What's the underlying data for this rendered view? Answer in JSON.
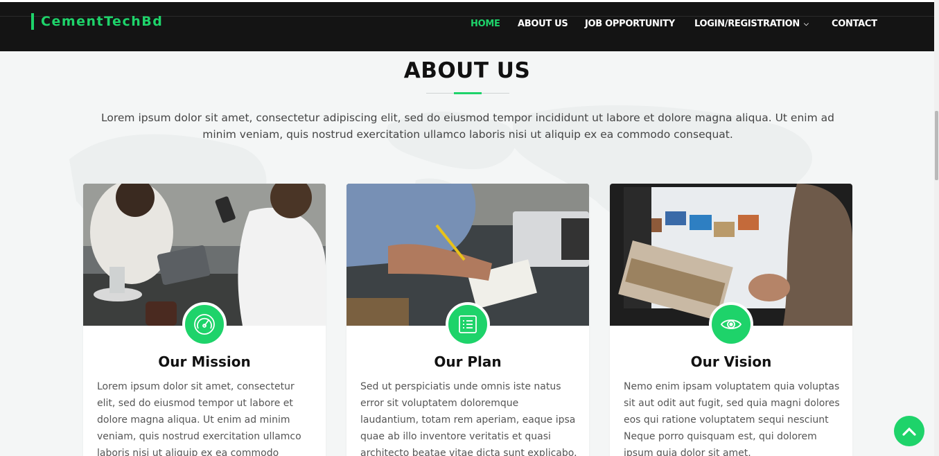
{
  "brand": {
    "name": "CementTechBd"
  },
  "nav": {
    "items": [
      {
        "label": "HOME",
        "active": true
      },
      {
        "label": "ABOUT US"
      },
      {
        "label": "JOB OPPORTUNITY"
      },
      {
        "label": "LOGIN/REGISTRATION",
        "has_dropdown": true
      },
      {
        "label": "CONTACT"
      }
    ]
  },
  "section": {
    "title": "ABOUT US",
    "intro": "Lorem ipsum dolor sit amet, consectetur adipiscing elit, sed do eiusmod tempor incididunt ut labore et dolore magna aliqua. Ut enim ad minim veniam, quis nostrud exercitation ullamco laboris nisi ut aliquip ex ea commodo consequat."
  },
  "cards": [
    {
      "icon": "speedometer-icon",
      "title": "Our Mission",
      "text": "Lorem ipsum dolor sit amet, consectetur elit, sed do eiusmod tempor ut labore et dolore magna aliqua. Ut enim ad minim veniam, quis nostrud exercitation ullamco laboris nisi ut aliquip ex ea commodo consequat."
    },
    {
      "icon": "list-icon",
      "title": "Our Plan",
      "text": "Sed ut perspiciatis unde omnis iste natus error sit voluptatem doloremque laudantium, totam rem aperiam, eaque ipsa quae ab illo inventore veritatis et quasi architecto beatae vitae dicta sunt explicabo."
    },
    {
      "icon": "eye-icon",
      "title": "Our Vision",
      "text": "Nemo enim ipsam voluptatem quia voluptas sit aut odit aut fugit, sed quia magni dolores eos qui ratione voluptatem sequi nesciunt Neque porro quisquam est, qui dolorem ipsum quia dolor sit amet."
    }
  ],
  "colors": {
    "accent": "#1ed36a",
    "navbar": "#141414"
  },
  "scroll_top": {
    "icon": "chevron-up-icon"
  }
}
